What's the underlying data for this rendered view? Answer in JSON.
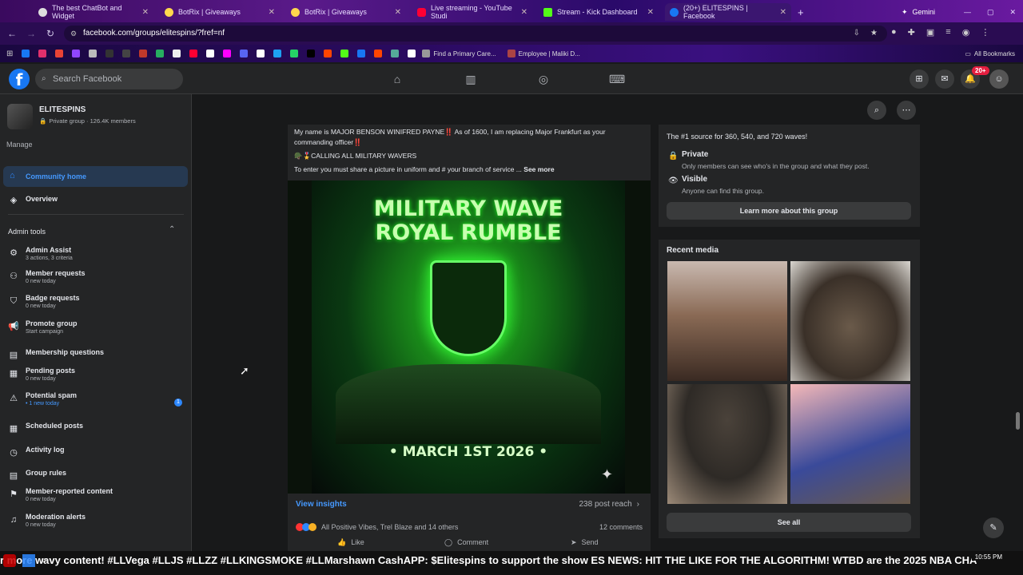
{
  "browser": {
    "tabs": [
      {
        "label": "The best ChatBot and Widget"
      },
      {
        "label": "BotRix | Giveaways"
      },
      {
        "label": "BotRix | Giveaways"
      },
      {
        "label": "Live streaming - YouTube Studi"
      },
      {
        "label": "Stream - Kick Dashboard"
      },
      {
        "label": "(20+) ELITESPINS | Facebook"
      }
    ],
    "gemini_label": "Gemini",
    "url": "facebook.com/groups/elitespins/?fref=nf",
    "bookmarks": {
      "find_care": "Find a Primary Care...",
      "employee": "Employee | Maliki D...",
      "all": "All Bookmarks"
    }
  },
  "fb": {
    "search_placeholder": "Search Facebook",
    "notif_badge": "20+"
  },
  "group": {
    "name": "ELITESPINS",
    "meta": "Private group · 126.4K members",
    "manage": "Manage",
    "community_home": "Community home",
    "overview": "Overview",
    "admin_tools": "Admin tools",
    "items": [
      {
        "title": "Admin Assist",
        "sub": "3 actions, 3 criteria",
        "icon": "gear-icon"
      },
      {
        "title": "Member requests",
        "sub": "0 new today",
        "icon": "person-add-icon"
      },
      {
        "title": "Badge requests",
        "sub": "0 new today",
        "icon": "badge-icon"
      },
      {
        "title": "Promote group",
        "sub": "Start campaign",
        "icon": "megaphone-icon"
      },
      {
        "title": "Membership questions",
        "sub": "",
        "icon": "clipboard-icon"
      },
      {
        "title": "Pending posts",
        "sub": "0 new today",
        "icon": "inbox-icon"
      },
      {
        "title": "Potential spam",
        "sub": "• 1 new today",
        "icon": "warning-icon"
      },
      {
        "title": "Scheduled posts",
        "sub": "",
        "icon": "calendar-icon"
      },
      {
        "title": "Activity log",
        "sub": "",
        "icon": "clock-icon"
      },
      {
        "title": "Group rules",
        "sub": "",
        "icon": "book-icon"
      },
      {
        "title": "Member-reported content",
        "sub": "0 new today",
        "icon": "flag-icon"
      },
      {
        "title": "Moderation alerts",
        "sub": "0 new today",
        "icon": "bell-icon"
      }
    ],
    "spam_count": "1"
  },
  "post": {
    "line1": "My name is MAJOR BENSON WINIFRED PAYNE‼️ As of 1600, I am replacing Major Frankfurt as your",
    "line2": "commanding officer‼️",
    "line3": "🪖🎖️CALLING ALL MILITARY WAVERS",
    "line4": "To enter you must share a picture in uniform and  # your branch of service ...",
    "see_more": "See more",
    "poster_title1": "MILITARY WAVE",
    "poster_title2": "ROYAL RUMBLE",
    "poster_date": "• MARCH 1ST 2026 •",
    "view_insights": "View insights",
    "reach": "238 post reach",
    "reactions": "All Positive Vibes, Trel Blaze and 14 others",
    "comments": "12 comments",
    "like": "Like",
    "comment": "Comment",
    "send": "Send"
  },
  "about": {
    "tagline": "The #1 source for 360, 540, and 720 waves!",
    "private_title": "Private",
    "private_desc": "Only members can see who's in the group and what they post.",
    "visible_title": "Visible",
    "visible_desc": "Anyone can find this group.",
    "learn_more": "Learn more about this group"
  },
  "media": {
    "title": "Recent media",
    "see_all": "See all"
  },
  "taskbar": {
    "ticker": "r more wavy content! #LLVega #LLJS #LLZZ #LLKINGSMOKE #LLMarshawn CashAPP: $Elitespins to support the show    ES NEWS: HIT THE LIKE FOR THE ALGORITHM! WTBD are the 2025 NBA CHA",
    "time": "10:55 PM"
  }
}
